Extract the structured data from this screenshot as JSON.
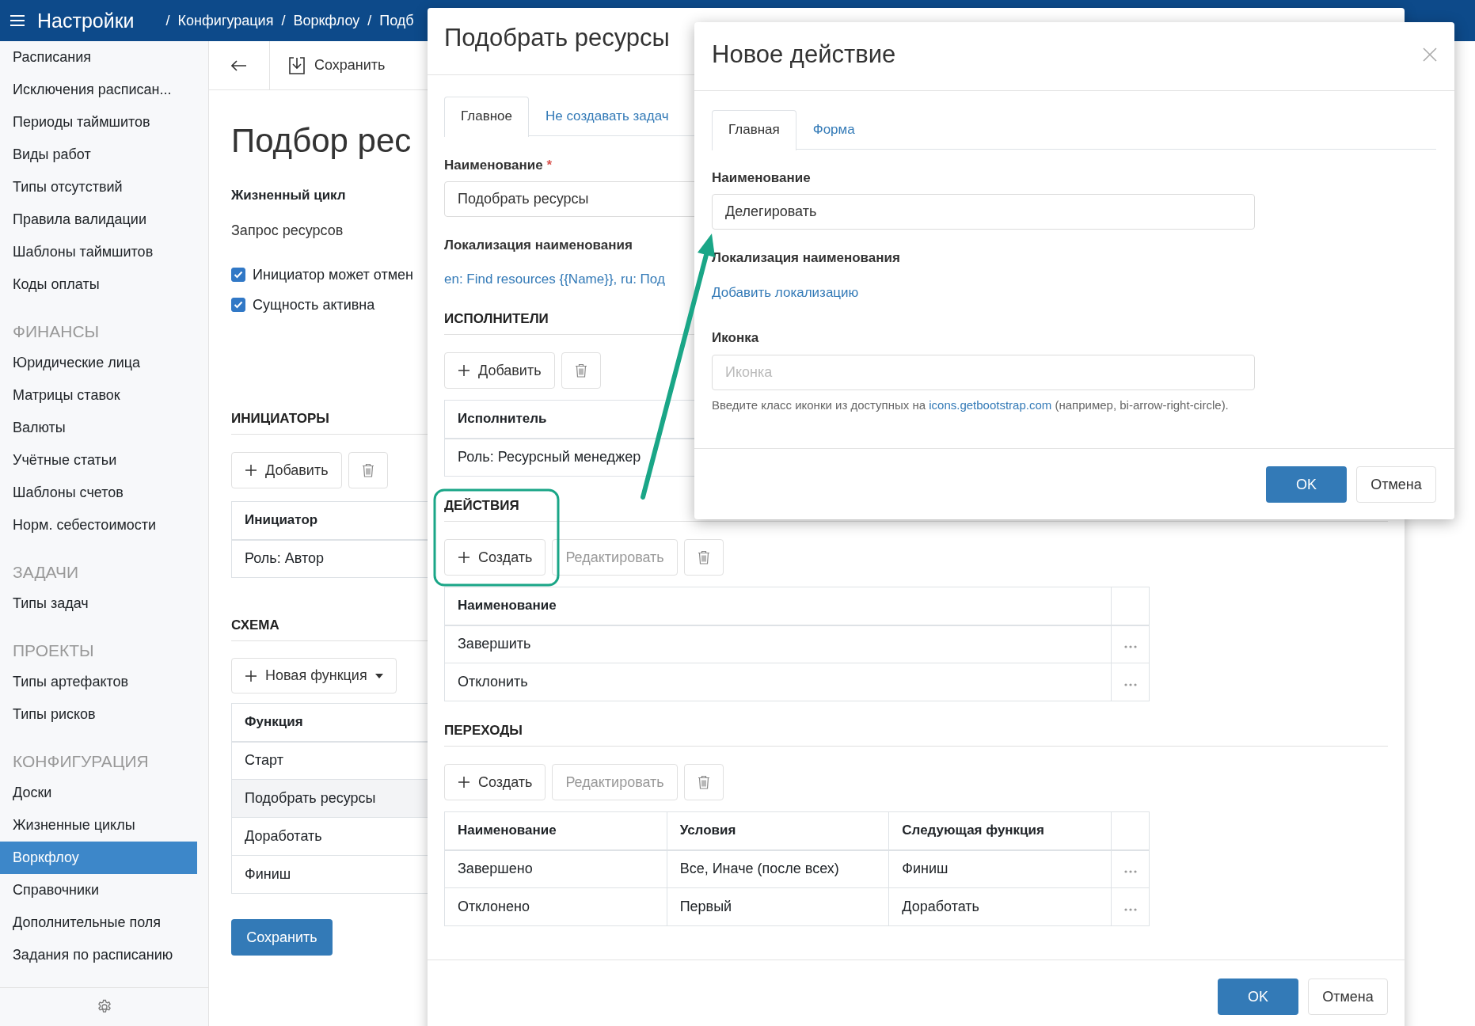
{
  "top_bar": {
    "title": "Настройки",
    "breadcrumb": [
      {
        "separator": "/",
        "label": "Конфигурация"
      },
      {
        "separator": "/",
        "label": "Воркфлоу"
      },
      {
        "separator": "/",
        "label": "Подб"
      }
    ]
  },
  "sidebar": {
    "sections": [
      {
        "items": [
          {
            "label": "Расписания",
            "selected": false
          },
          {
            "label": "Исключения расписан...",
            "selected": false
          },
          {
            "label": "Периоды таймшитов",
            "selected": false
          },
          {
            "label": "Виды работ",
            "selected": false
          },
          {
            "label": "Типы отсутствий",
            "selected": false
          },
          {
            "label": "Правила валидации",
            "selected": false
          },
          {
            "label": "Шаблоны таймшитов",
            "selected": false
          },
          {
            "label": "Коды оплаты",
            "selected": false
          }
        ]
      },
      {
        "heading": "ФИНАНСЫ",
        "items": [
          {
            "label": "Юридические лица",
            "selected": false
          },
          {
            "label": "Матрицы ставок",
            "selected": false
          },
          {
            "label": "Валюты",
            "selected": false
          },
          {
            "label": "Учётные статьи",
            "selected": false
          },
          {
            "label": "Шаблоны счетов",
            "selected": false
          },
          {
            "label": "Норм. себестоимости",
            "selected": false
          }
        ]
      },
      {
        "heading": "ЗАДАЧИ",
        "items": [
          {
            "label": "Типы задач",
            "selected": false
          }
        ]
      },
      {
        "heading": "ПРОЕКТЫ",
        "items": [
          {
            "label": "Типы артефактов",
            "selected": false
          },
          {
            "label": "Типы рисков",
            "selected": false
          }
        ]
      },
      {
        "heading": "КОНФИГУРАЦИЯ",
        "items": [
          {
            "label": "Доски",
            "selected": false
          },
          {
            "label": "Жизненные циклы",
            "selected": false
          },
          {
            "label": "Воркфлоу",
            "selected": true
          },
          {
            "label": "Справочники",
            "selected": false
          },
          {
            "label": "Дополнительные поля",
            "selected": false
          },
          {
            "label": "Задания по расписанию",
            "selected": false
          }
        ]
      }
    ]
  },
  "page": {
    "toolbar": {
      "save": "Сохранить"
    },
    "title": "Подбор рес",
    "lifecycle": {
      "label": "Жизненный цикл",
      "value": "Запрос ресурсов"
    },
    "checkboxes": [
      {
        "label": "Инициатор может отмен",
        "checked": true
      },
      {
        "label": "Сущность активна",
        "checked": true
      }
    ],
    "initiators": {
      "heading": "ИНИЦИАТОРЫ",
      "buttons": [
        {
          "kind": "add",
          "label": "Добавить",
          "disabled": false
        },
        {
          "kind": "delete"
        }
      ],
      "columns": [
        "Инициатор"
      ],
      "rows": [
        {
          "cells": [
            "Роль: Автор"
          ]
        }
      ]
    },
    "schema": {
      "heading": "СХЕМА",
      "new_function": "Новая функция",
      "columns": [
        "Функция"
      ],
      "rows": [
        {
          "cells": [
            "Старт"
          ],
          "selected": false
        },
        {
          "cells": [
            "Подобрать ресурсы"
          ],
          "selected": true
        },
        {
          "cells": [
            "Доработать"
          ],
          "selected": false
        },
        {
          "cells": [
            "Финиш"
          ],
          "selected": false
        }
      ]
    },
    "save_button": "Сохранить"
  },
  "edit_dialog": {
    "title": "Подобрать ресурсы",
    "tabs": [
      {
        "label": "Главное",
        "selected": true
      },
      {
        "label": "Не создавать задач",
        "selected": false
      }
    ],
    "name": {
      "label": "Наименование",
      "required_mark": "*",
      "value": "Подобрать ресурсы"
    },
    "localization": {
      "label": "Локализация наименования",
      "link": "en: Find resources {{Name}}, ru: Под"
    },
    "sections": [
      {
        "heading": "ИСПОЛНИТЕЛИ",
        "buttons": [
          {
            "kind": "add",
            "label": "Добавить",
            "disabled": false
          },
          {
            "kind": "delete"
          }
        ],
        "columns": [
          "Исполнитель"
        ],
        "rows": [
          {
            "cells": [
              "Роль: Ресурсный менеджер"
            ]
          }
        ]
      },
      {
        "heading": "ДЕЙСТВИЯ",
        "buttons": [
          {
            "kind": "add",
            "label": "Создать",
            "disabled": false
          },
          {
            "kind": "plain",
            "label": "Редактировать",
            "disabled": true
          },
          {
            "kind": "delete"
          }
        ],
        "columns": [
          "Наименование"
        ],
        "rows": [
          {
            "cells": [
              "Завершить"
            ]
          },
          {
            "cells": [
              "Отклонить"
            ]
          }
        ]
      },
      {
        "heading": "ПЕРЕХОДЫ",
        "buttons": [
          {
            "kind": "add",
            "label": "Создать",
            "disabled": false
          },
          {
            "kind": "plain",
            "label": "Редактировать",
            "disabled": true
          },
          {
            "kind": "delete"
          }
        ],
        "columns": [
          "Наименование",
          "Условия",
          "Следующая функция"
        ],
        "rows": [
          {
            "cells": [
              "Завершено",
              "Все, Иначе (после всех)",
              "Финиш"
            ]
          },
          {
            "cells": [
              "Отклонено",
              "Первый",
              "Доработать"
            ]
          }
        ]
      }
    ],
    "ok": "OK",
    "cancel": "Отмена"
  },
  "action_dialog": {
    "title": "Новое действие",
    "tabs": [
      {
        "label": "Главная",
        "selected": true
      },
      {
        "label": "Форма",
        "selected": false
      }
    ],
    "name": {
      "label": "Наименование",
      "value": "Делегировать"
    },
    "localization": {
      "label": "Локализация наименования",
      "link": "Добавить локализацию"
    },
    "icon": {
      "label": "Иконка",
      "placeholder": "Иконка"
    },
    "help": {
      "before": "Введите класс иконки из доступных на",
      "link": "icons.getbootstrap.com",
      "after": "(например, bi-arrow-right-circle)."
    },
    "ok": "OK",
    "cancel": "Отмена"
  }
}
